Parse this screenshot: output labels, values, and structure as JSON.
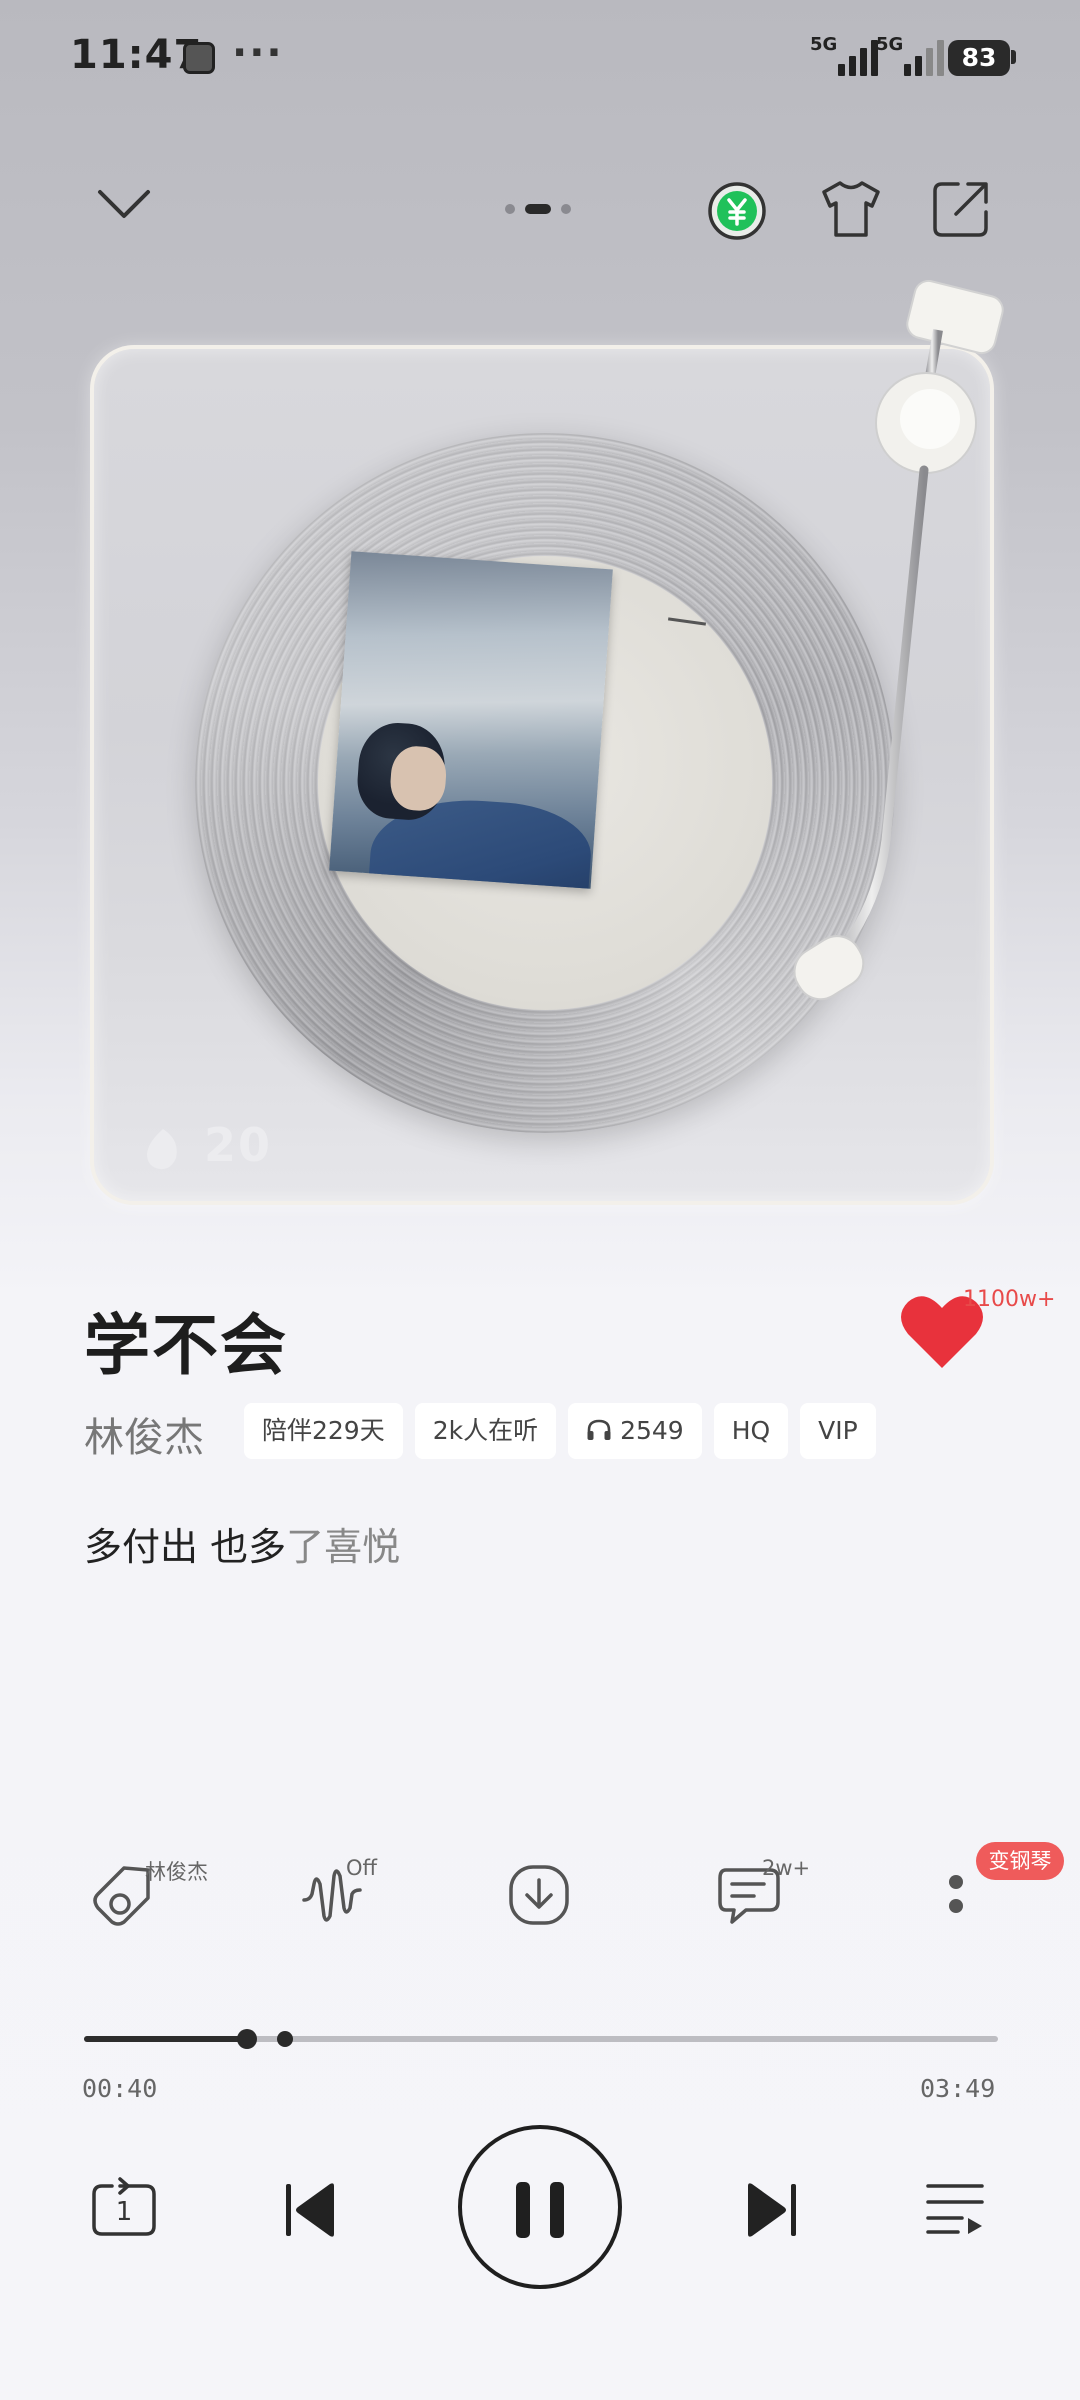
{
  "status_bar": {
    "time": "11:47",
    "network_1": "5G",
    "network_2": "5G",
    "battery": "83"
  },
  "top_nav": {
    "collapse_icon": "chevron-down-icon",
    "vip_icon": "yuan-coin-icon",
    "skin_icon": "tshirt-icon",
    "share_icon": "share-icon",
    "page_count": 3,
    "active_page": 2
  },
  "player_card": {
    "badge_text": "20"
  },
  "song": {
    "title": "学不会",
    "artist": "林俊杰",
    "tags": [
      "陪伴229天",
      "2k人在听",
      "2549",
      "HQ",
      "VIP"
    ],
    "lyric_sung": "多付出 也多",
    "lyric_rest": "了喜悦",
    "likes": "1100w+"
  },
  "actions": {
    "singer_label": "林俊杰",
    "effect_label": "Off",
    "comments_label": "2w+",
    "piano_badge": "变钢琴"
  },
  "progress": {
    "current": "00:40",
    "total": "03:49",
    "played_fraction": 0.178,
    "marker_fraction": 0.22
  },
  "colors": {
    "accent_red": "#ef5b5b",
    "heart_red": "#e8323c",
    "vip_green": "#1db954"
  }
}
